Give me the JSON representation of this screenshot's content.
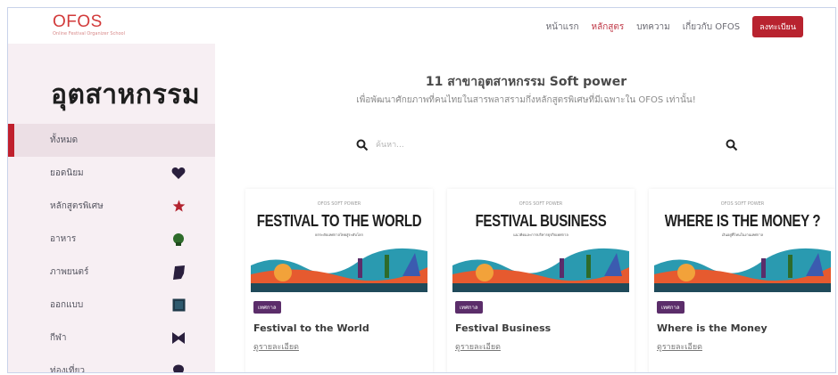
{
  "logo": {
    "text": "OFOS",
    "subtext": "Online Festival Organizer School"
  },
  "nav": {
    "items": [
      {
        "label": "หน้าแรก",
        "active": false
      },
      {
        "label": "หลักสูตร",
        "active": true
      },
      {
        "label": "บทความ",
        "active": false
      },
      {
        "label": "เกี่ยวกับ OFOS",
        "active": false
      }
    ],
    "register_label": "ลงทะเบียน"
  },
  "sidebar": {
    "title": "อุตสาหกรรม",
    "items": [
      {
        "label": "ทั้งหมด",
        "icon": "",
        "active": true
      },
      {
        "label": "ยอดนิยม",
        "icon": "heart-icon"
      },
      {
        "label": "หลักสูตรพิเศษ",
        "icon": "star-icon"
      },
      {
        "label": "อาหาร",
        "icon": "food-icon"
      },
      {
        "label": "ภาพยนตร์",
        "icon": "film-icon"
      },
      {
        "label": "ออกแบบ",
        "icon": "design-icon"
      },
      {
        "label": "กีฬา",
        "icon": "sport-icon"
      },
      {
        "label": "ท่องเที่ยว",
        "icon": "travel-icon"
      }
    ]
  },
  "main": {
    "title": "11 สาขาอุตสาหกรรม Soft power",
    "subtitle": "เพื่อพัฒนาศักยภาพที่คนไทยในสารพลาสรามกึ่งหลักสูตรพิเศษที่มีเฉพาะใน OFOS เท่านั้น!",
    "search": {
      "placeholder": "ค้นหา..."
    }
  },
  "courses": [
    {
      "kicker": "OFOS SOFT POWER",
      "headline": "FESTIVAL TO THE WORLD",
      "tagline": "ยกระดับเทศกาลไทยสู่ระดับโลก",
      "badge": "เทศกาล",
      "title": "Festival to the World",
      "link": "ดูรายละเอียด"
    },
    {
      "kicker": "OFOS SOFT POWER",
      "headline": "FESTIVAL BUSINESS",
      "tagline": "แนวคิดและการบริหารธุรกิจเทศกาล",
      "badge": "เทศกาล",
      "title": "Festival Business",
      "link": "ดูรายละเอียด"
    },
    {
      "kicker": "OFOS SOFT POWER",
      "headline": "WHERE IS THE MONEY ?",
      "tagline": "เงินอยู่ที่ไหนในงานเทศกาล",
      "badge": "เทศกาล",
      "title": "Where is the Money",
      "link": "ดูรายละเอียด"
    }
  ],
  "colors": {
    "brand_red": "#c0202d",
    "badge_purple": "#5b2d6a",
    "sidebar_bg": "#f7eff3",
    "icon_dark": "#2a1f3d"
  }
}
